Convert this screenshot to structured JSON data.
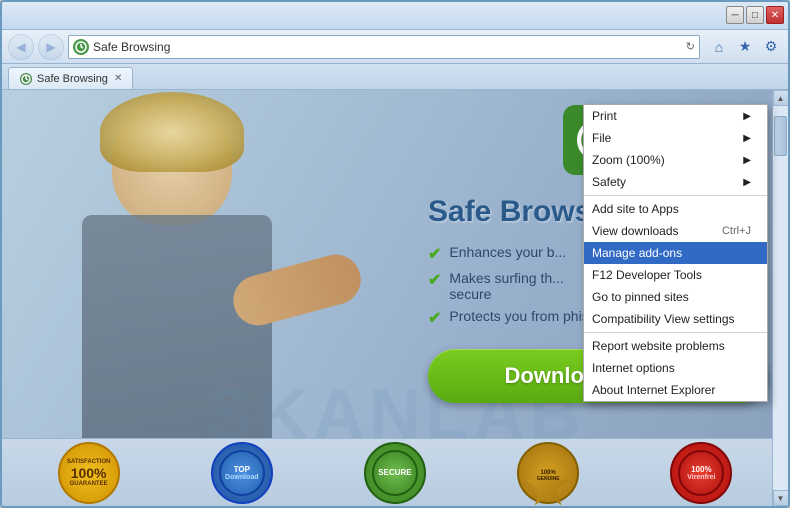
{
  "browser": {
    "title": "Safe Browsing",
    "tab_label": "Safe Browsing",
    "address": "Safe Browsing",
    "nav": {
      "back_label": "◀",
      "forward_label": "▶",
      "refresh_label": "↻"
    },
    "controls": {
      "minimize": "─",
      "maximize": "□",
      "close": "✕"
    }
  },
  "page": {
    "title": "Safe Brows",
    "logo_alt": "Safe Browsing logo",
    "features": [
      "Enhances your b...",
      "Makes surfing th... secure",
      "Protects you from phishing attacts"
    ],
    "download_btn": "Download for free",
    "watermark": "SKANLAB"
  },
  "badges": [
    {
      "line1": "SATISFACTION",
      "line2": "100%",
      "line3": "GUARANTEE"
    },
    {
      "line1": "TOP",
      "line2": "Download"
    },
    {
      "line1": "SECURE"
    },
    {
      "line1": "100%",
      "line2": "GENUINE"
    },
    {
      "line1": "100%",
      "line2": "Virenfrei"
    }
  ],
  "context_menu": {
    "items": [
      {
        "label": "Print",
        "shortcut": "",
        "arrow": true,
        "divider_after": false
      },
      {
        "label": "File",
        "shortcut": "",
        "arrow": true,
        "divider_after": false
      },
      {
        "label": "Zoom (100%)",
        "shortcut": "",
        "arrow": true,
        "divider_after": false
      },
      {
        "label": "Safety",
        "shortcut": "",
        "arrow": true,
        "divider_after": true
      },
      {
        "label": "Add site to Apps",
        "shortcut": "",
        "arrow": false,
        "divider_after": false
      },
      {
        "label": "View downloads",
        "shortcut": "Ctrl+J",
        "arrow": false,
        "divider_after": false
      },
      {
        "label": "Manage add-ons",
        "shortcut": "",
        "arrow": false,
        "highlighted": true,
        "divider_after": false
      },
      {
        "label": "F12 Developer Tools",
        "shortcut": "",
        "arrow": false,
        "divider_after": false
      },
      {
        "label": "Go to pinned sites",
        "shortcut": "",
        "arrow": false,
        "divider_after": false
      },
      {
        "label": "Compatibility View settings",
        "shortcut": "",
        "arrow": false,
        "divider_after": true
      },
      {
        "label": "Report website problems",
        "shortcut": "",
        "arrow": false,
        "divider_after": false
      },
      {
        "label": "Internet options",
        "shortcut": "",
        "arrow": false,
        "divider_after": false
      },
      {
        "label": "About Internet Explorer",
        "shortcut": "",
        "arrow": false,
        "divider_after": false
      }
    ]
  }
}
